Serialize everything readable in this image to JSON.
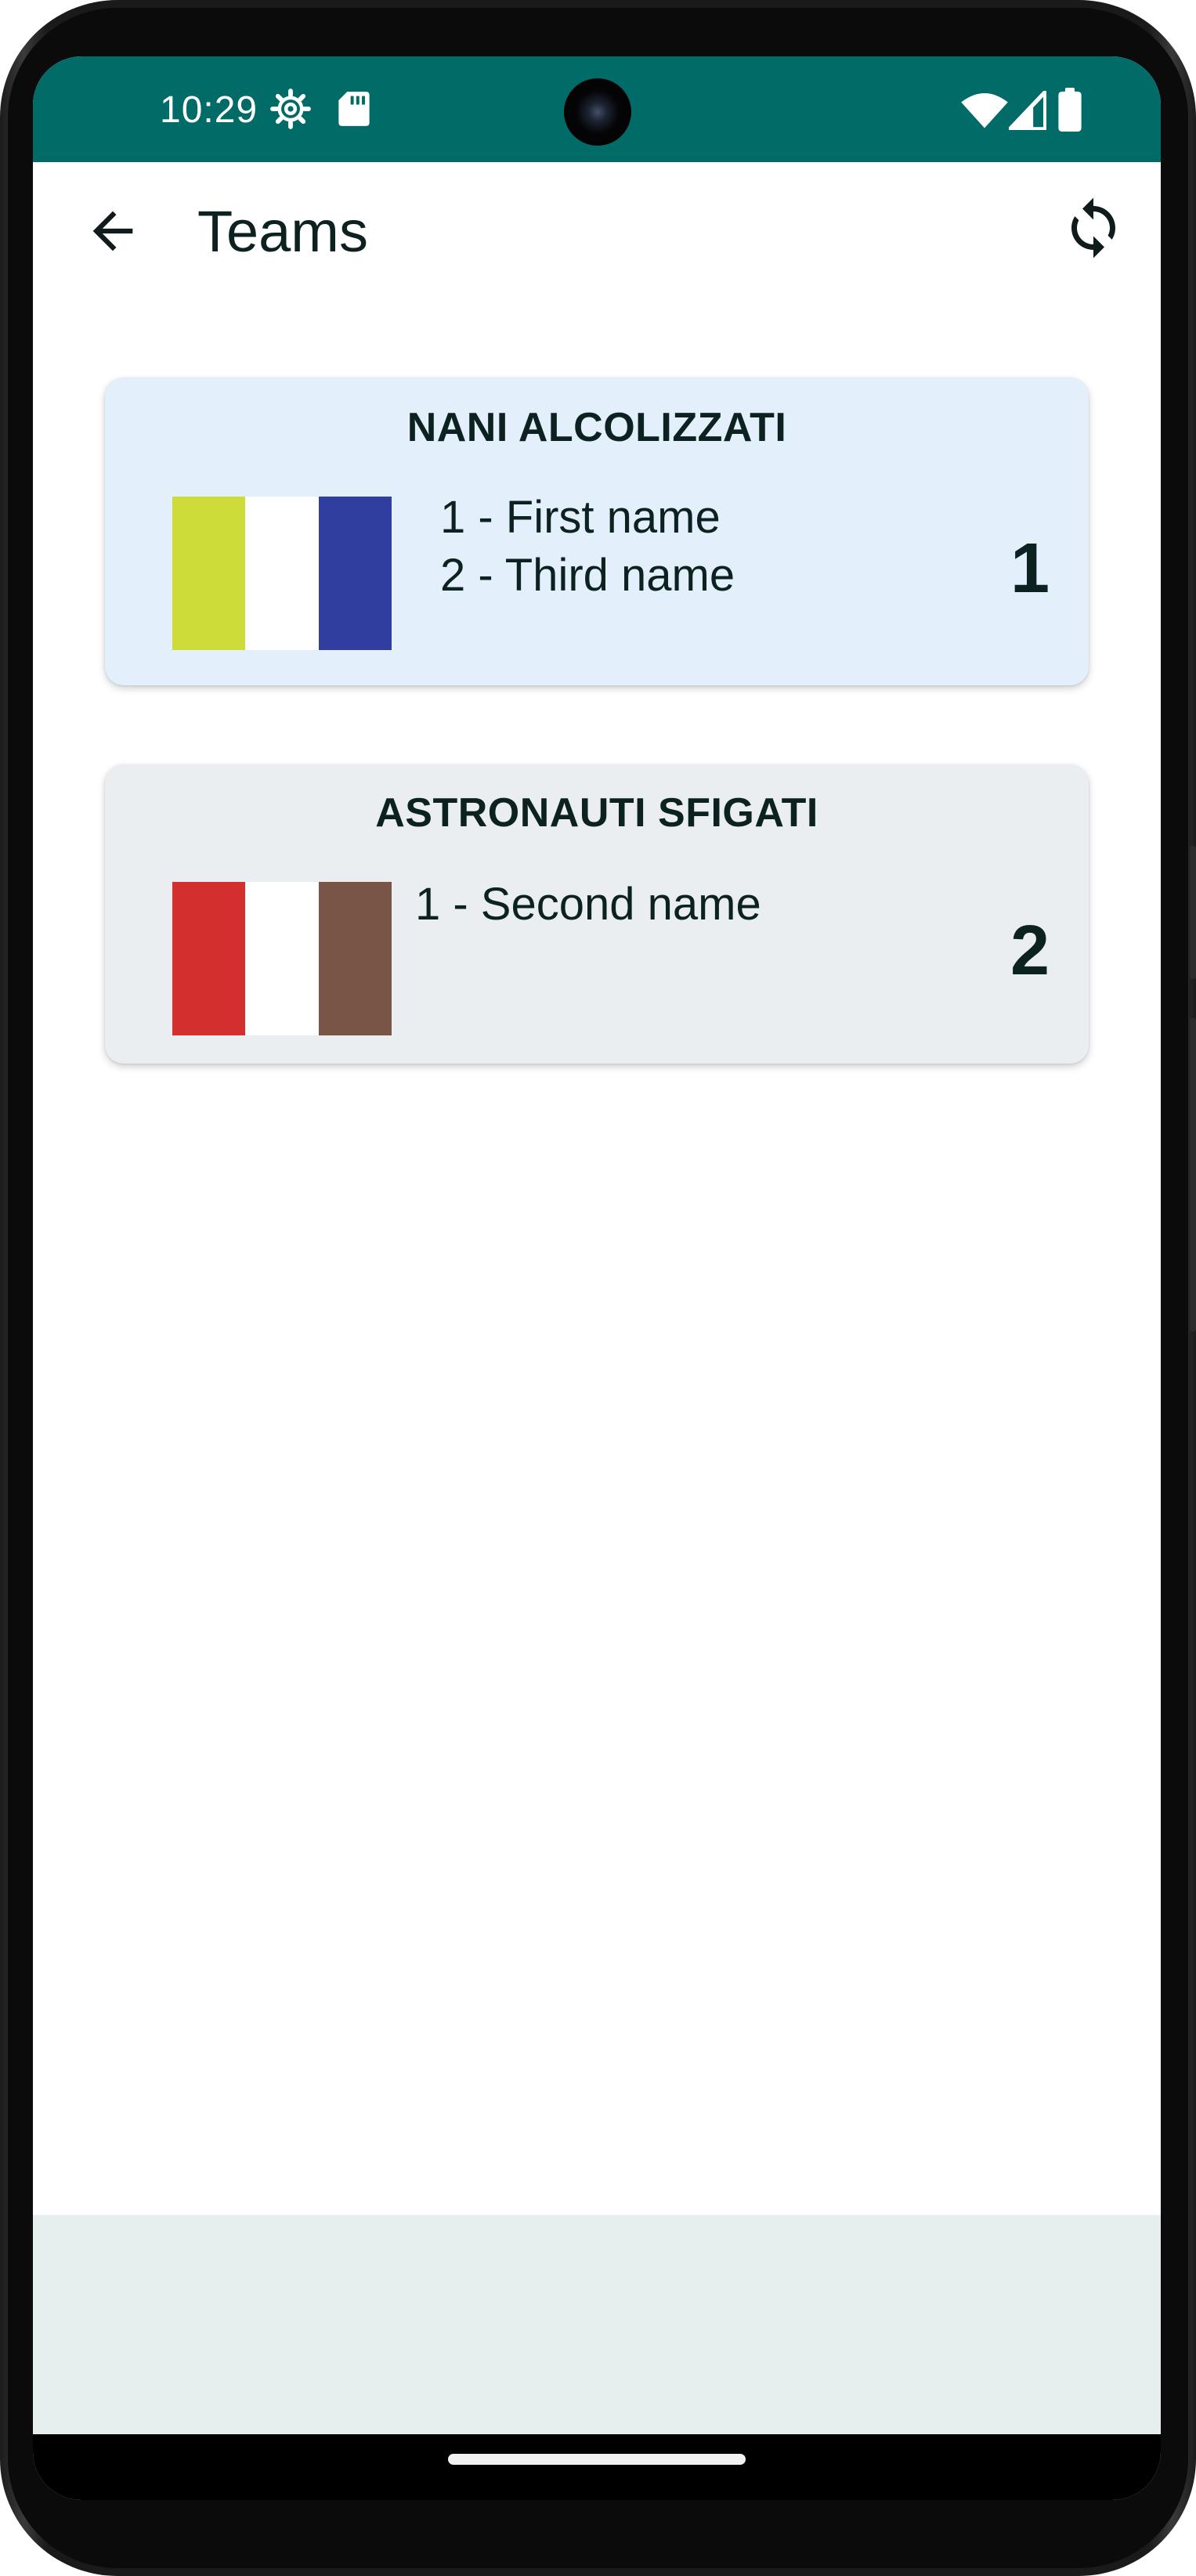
{
  "status_bar": {
    "time": "10:29",
    "background": "#016b68",
    "icons": [
      "settings-gear-icon",
      "sd-card-icon",
      "wifi-icon",
      "cell-signal-icon",
      "battery-icon"
    ]
  },
  "app_bar": {
    "title": "Teams",
    "back_icon": "arrow-left-icon",
    "refresh_icon": "sync-icon"
  },
  "teams": [
    {
      "name": "NANI ALCOLIZZATI",
      "card_color": "#e3f0fb",
      "flag_colors": [
        "#cddc39",
        "#ffffff",
        "#303f9f"
      ],
      "members": [
        "1 - First name",
        "2 - Third name"
      ],
      "rank": "1"
    },
    {
      "name": "ASTRONAUTI SFIGATI",
      "card_color": "#eaeef1",
      "flag_colors": [
        "#d32f2f",
        "#ffffff",
        "#795548"
      ],
      "members": [
        "1 - Second name"
      ],
      "rank": "2"
    }
  ],
  "bottom_panel_color": "#e6efed"
}
